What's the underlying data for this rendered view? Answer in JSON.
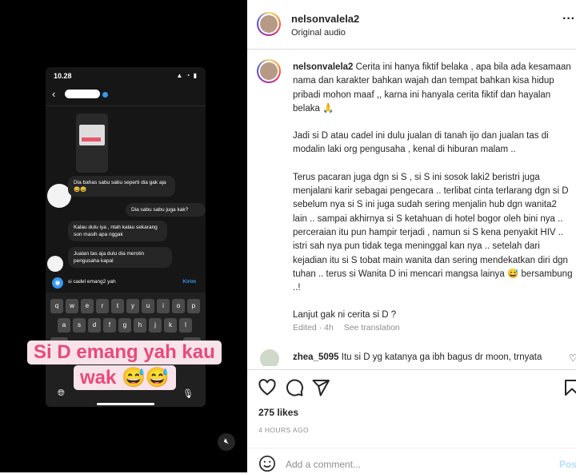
{
  "media": {
    "status_time": "10.28",
    "status_icons": "▲ ◔ ▮",
    "messages": [
      "Dia bahas sabu sabu seperti dia gak aja 😅😅",
      "Dia sabu sabu juga kak?",
      "Kalau dulu iya , ntah kalau sekarang son masih apa nggak",
      "Jualan tas aja dulu dia merotin pengusaha kapal"
    ],
    "composer_text": "si cadel emang2 yah",
    "send_label": "Kirim",
    "keyboard_row1": [
      "q",
      "w",
      "e",
      "r",
      "t",
      "y",
      "u",
      "i",
      "o",
      "p"
    ],
    "keyboard_row2": [
      "a",
      "s",
      "d",
      "f",
      "g",
      "h",
      "j",
      "k",
      "l"
    ],
    "caption_line1": "Si D emang yah kau",
    "caption_line2": "wak 😅😅"
  },
  "post": {
    "username": "nelsonvalela2",
    "audio": "Original audio",
    "caption_user": "nelsonvalela2",
    "caption_p1": "Cerita ini hanya fiktif belaka , apa bila ada kesamaan nama dan karakter bahkan wajah dan tempat bahkan kisa hidup pribadi mohon maaf ,, karna ini hanyala cerita fiktif dan hayalan belaka 🙏",
    "caption_p2": "Jadi si D atau cadel ini dulu jualan di tanah ijo dan jualan tas di modalin laki org pengusaha , kenal di hiburan malam ..",
    "caption_p3": "Terus pacaran juga dgn si S , si S ini sosok laki2 beristri juga menjalani karir sebagai pengecara .. terlibat cinta terlarang dgn si D sebelum nya si S ini juga sudah sering menjalin hub dgn wanita2 lain .. sampai akhirnya si S ketahuan di hotel bogor oleh bini nya .. perceraian itu pun hampir terjadi , namun si S kena penyakit HIV .. istri sah nya pun tidak tega meninggal kan nya .. setelah dari kejadian itu si S tobat main wanita dan sering mendekatkan diri dgn tuhan .. terus si Wanita D ini mencari mangsa lainya 😅 bersambung ..!",
    "caption_p4": "Lanjut gak ni cerita si D ?",
    "edited": "Edited · 4h",
    "see_translation": "See translation",
    "comment_user": "zhea_5095",
    "comment_text": "Itu si D yg katanya ga ibh bagus dr moon, trnyata",
    "likes": "275 likes",
    "time": "4 HOURS AGO",
    "add_comment_placeholder": "Add a comment...",
    "post_label": "Post"
  }
}
